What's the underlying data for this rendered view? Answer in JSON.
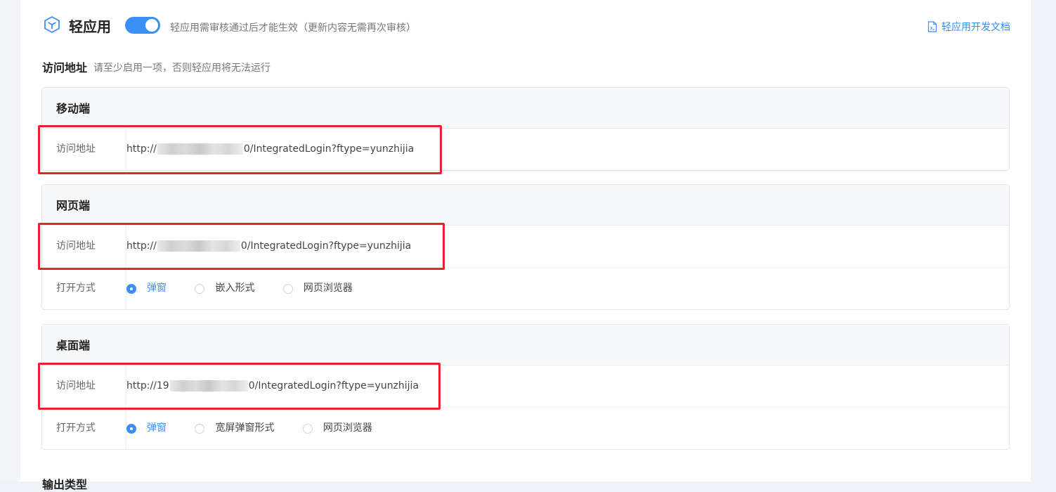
{
  "header": {
    "title": "轻应用",
    "toggle_on": true,
    "hint": "轻应用需审核通过后才能生效（更新内容无需再次审核）",
    "doc_link": "轻应用开发文档"
  },
  "access": {
    "title": "访问地址",
    "hint": "请至少启用一项，否则轻应用将无法运行"
  },
  "mobile": {
    "title": "移动端",
    "url_label": "访问地址",
    "url_prefix": "http://",
    "url_suffix": "0/IntegratedLogin?ftype=yunzhijia"
  },
  "web": {
    "title": "网页端",
    "url_label": "访问地址",
    "url_prefix": "http://",
    "url_suffix": "0/IntegratedLogin?ftype=yunzhijia",
    "open_label": "打开方式",
    "options": [
      "弹窗",
      "嵌入形式",
      "网页浏览器"
    ],
    "selected": "弹窗"
  },
  "desktop": {
    "title": "桌面端",
    "url_label": "访问地址",
    "url_prefix": "http://19",
    "url_suffix": "0/IntegratedLogin?ftype=yunzhijia",
    "open_label": "打开方式",
    "options": [
      "弹窗",
      "宽屏弹窗形式",
      "网页浏览器"
    ],
    "selected": "弹窗"
  },
  "next_section_title": "输出类型",
  "colors": {
    "accent": "#3a8ff5",
    "highlight": "#e8232b"
  }
}
